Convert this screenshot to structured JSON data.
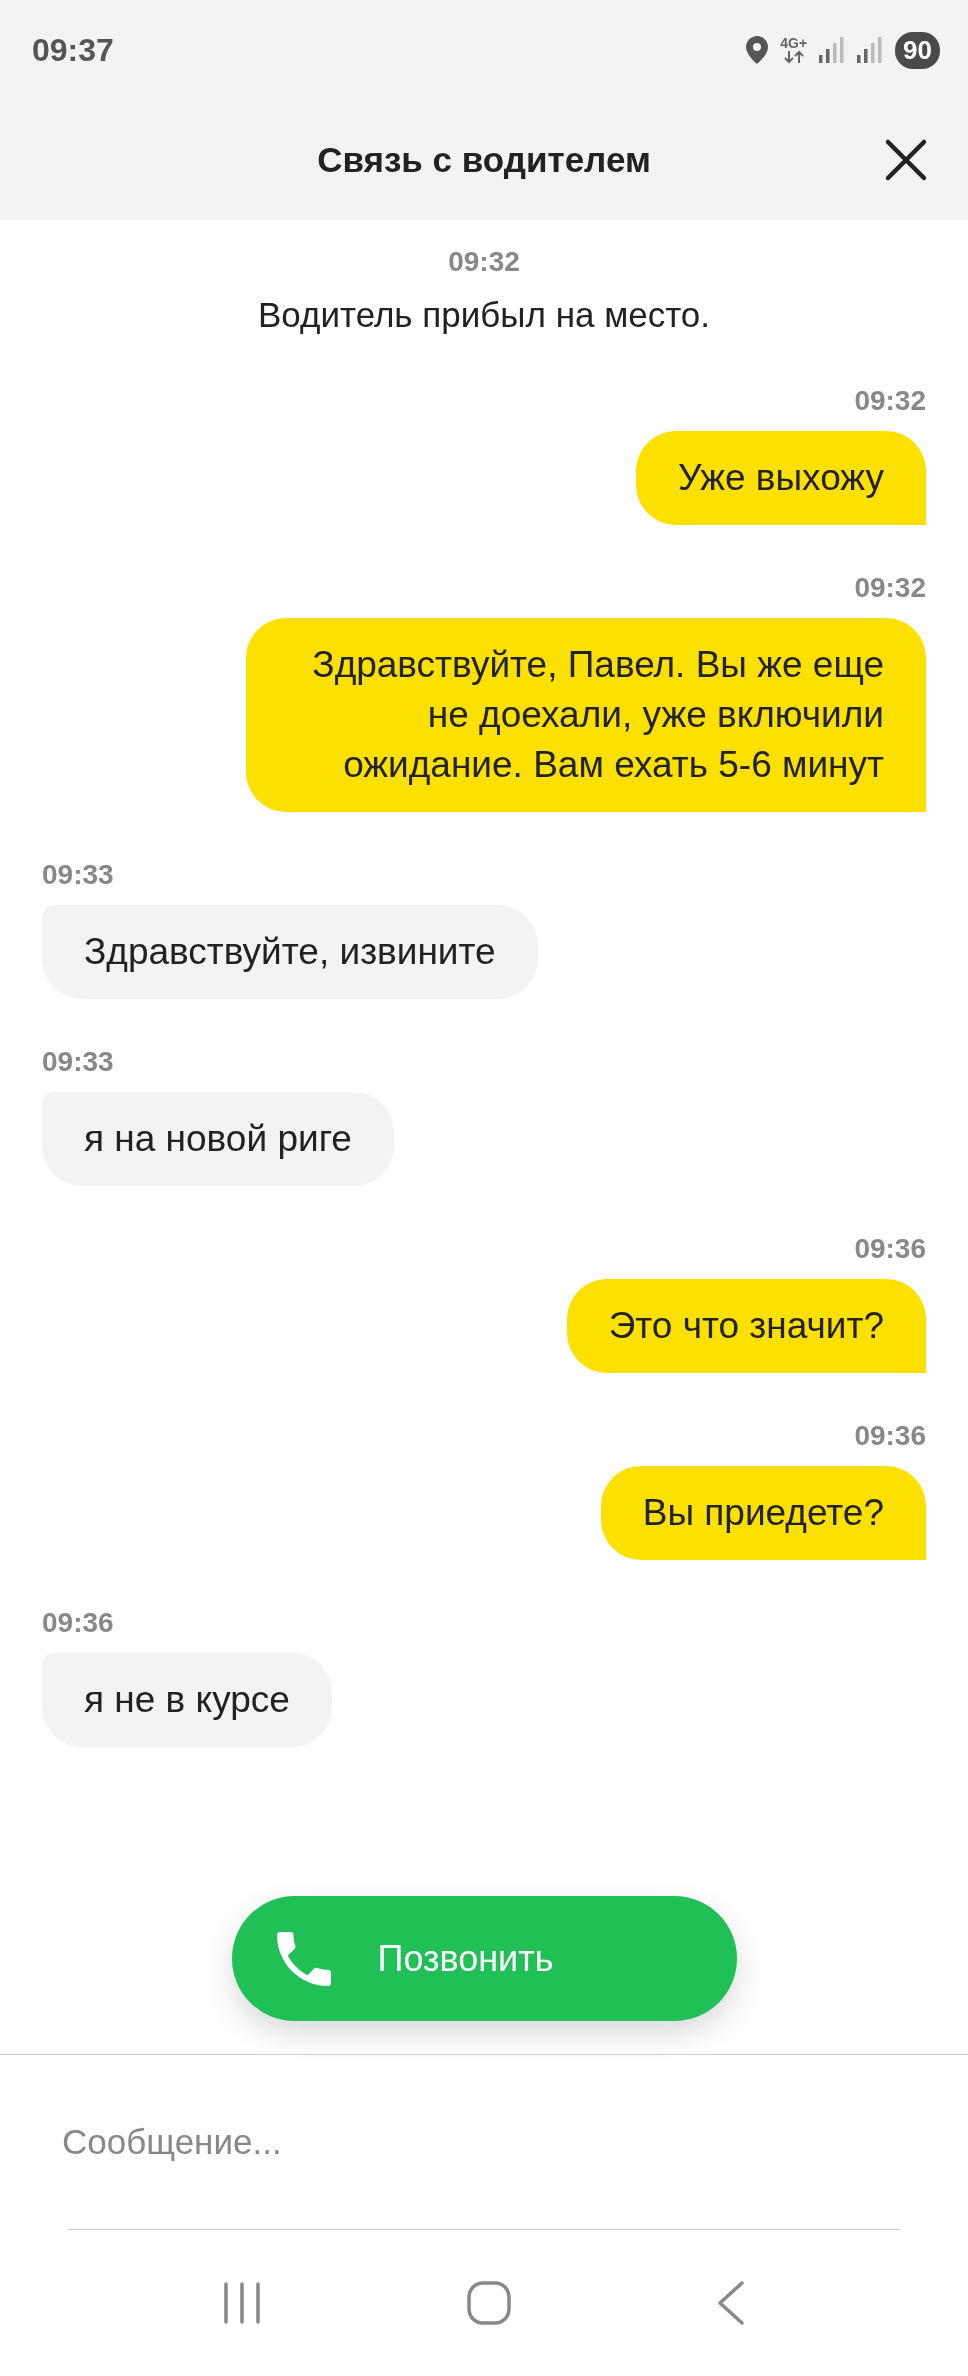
{
  "status_bar": {
    "time": "09:37",
    "network": "4G+",
    "battery": "90"
  },
  "header": {
    "title": "Связь с водителем"
  },
  "messages": [
    {
      "kind": "system",
      "time": "09:32",
      "text": "Водитель прибыл на место."
    },
    {
      "kind": "outgoing",
      "time": "09:32",
      "text": "Уже выхожу"
    },
    {
      "kind": "outgoing",
      "time": "09:32",
      "text": "Здравствуйте, Павел. Вы же еще не доехали, уже включили ожидание. Вам ехать 5-6 минут"
    },
    {
      "kind": "incoming",
      "time": "09:33",
      "text": "Здравствуйте, извините"
    },
    {
      "kind": "incoming",
      "time": "09:33",
      "text": "я на новой риге"
    },
    {
      "kind": "outgoing",
      "time": "09:36",
      "text": "Это что значит?"
    },
    {
      "kind": "outgoing",
      "time": "09:36",
      "text": "Вы приедете?"
    },
    {
      "kind": "incoming",
      "time": "09:36",
      "text": "я не в курсе"
    }
  ],
  "call_button": {
    "label": "Позвонить"
  },
  "composer": {
    "placeholder": "Сообщение..."
  }
}
